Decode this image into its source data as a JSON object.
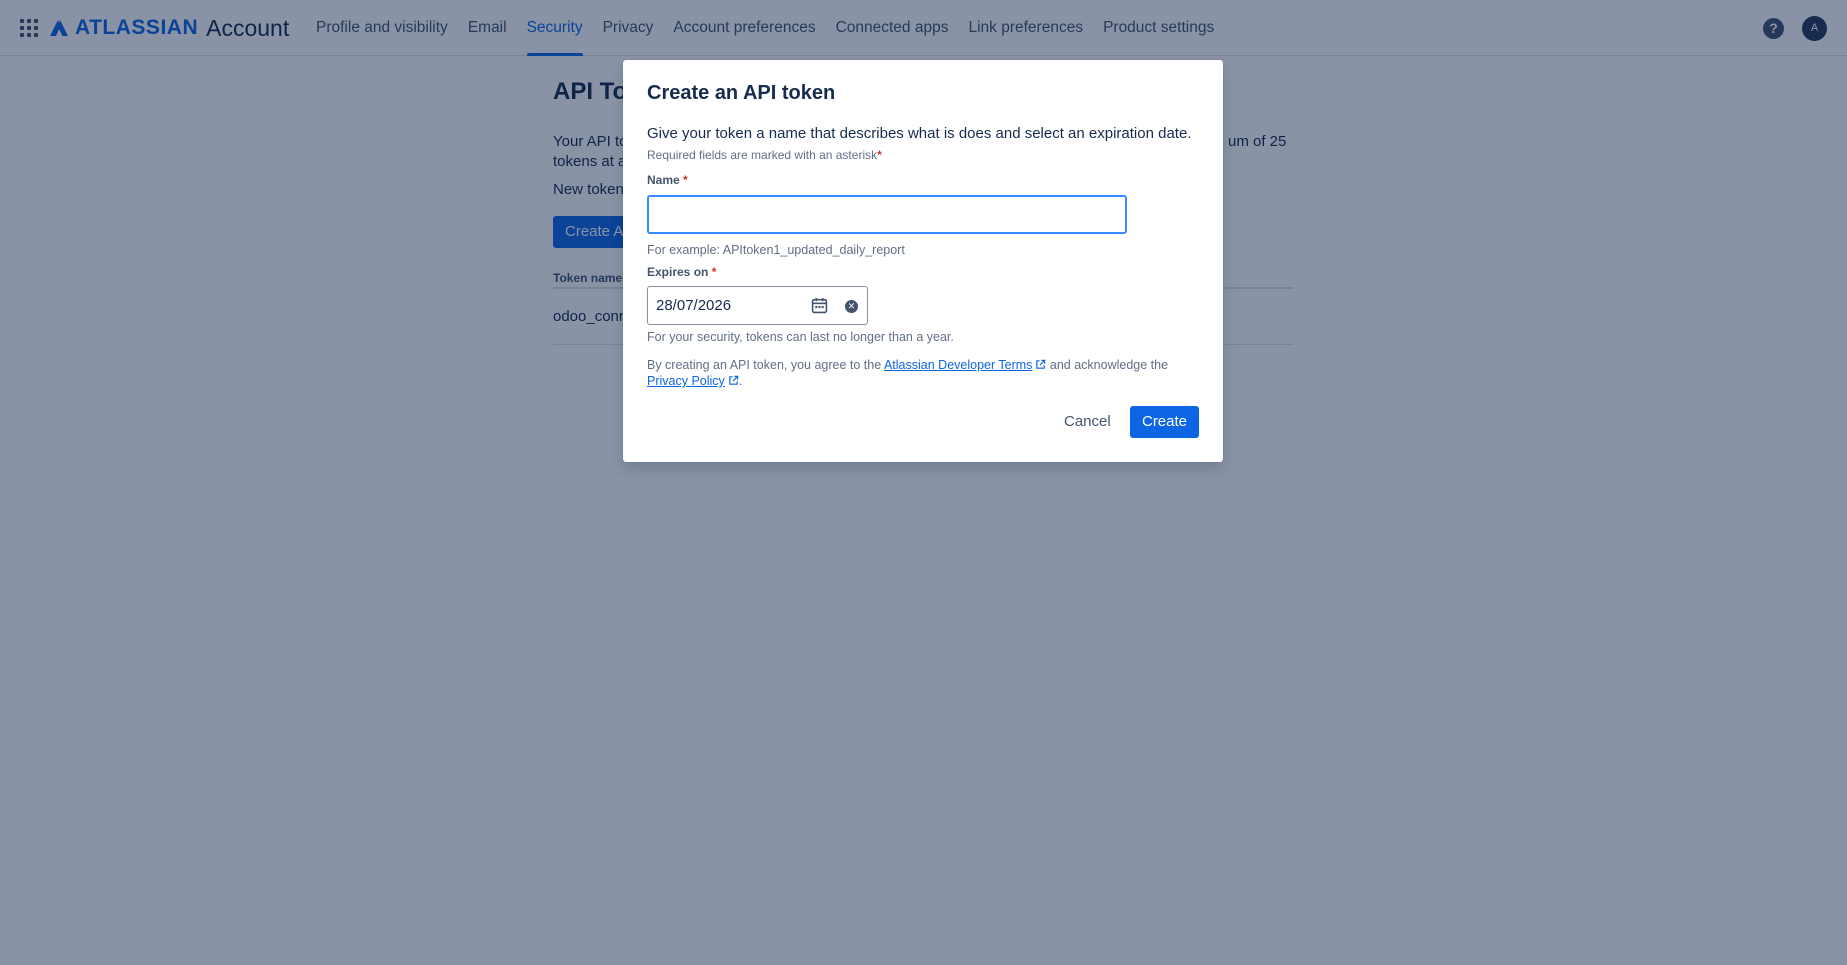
{
  "header": {
    "brand": "ATLASSIAN",
    "product": "Account",
    "nav": [
      {
        "label": "Profile and visibility"
      },
      {
        "label": "Email"
      },
      {
        "label": "Security"
      },
      {
        "label": "Privacy"
      },
      {
        "label": "Account preferences"
      },
      {
        "label": "Connected apps"
      },
      {
        "label": "Link preferences"
      },
      {
        "label": "Product settings"
      }
    ],
    "active_nav": "Security",
    "help_label": "?",
    "avatar_initial": "A"
  },
  "background_page": {
    "title": "API To",
    "description": "Your API to                                                                                                                                  um of 25 tokens at a",
    "description_left": "Your API to",
    "description_right": "um of 25",
    "description_line2": "tokens at a",
    "note": "New token",
    "create_button": "Create A",
    "table_header": "Token name",
    "row_token": "odoo_conr"
  },
  "modal": {
    "title": "Create an API token",
    "description": "Give your token a name that describes what is does and select an expiration date.",
    "required_note": "Required fields are marked with an asterisk",
    "required_mark": "*",
    "name_label": "Name",
    "name_value": "",
    "name_helper": "For example: APItoken1_updated_daily_report",
    "expires_label": "Expires on",
    "expires_value": "28/07/2026",
    "expires_helper": "For your security, tokens can last no longer than a year.",
    "terms_prefix": "By creating an API token, you agree to the ",
    "terms_link": "Atlassian Developer Terms",
    "terms_middle": " and acknowledge the",
    "privacy_link": "Privacy Policy",
    "terms_suffix": ".",
    "cancel_label": "Cancel",
    "create_label": "Create"
  },
  "colors": {
    "brand": "#0c66e4",
    "text": "#172b4d",
    "subtle": "#626f86",
    "focus": "#388bff",
    "required": "#c9372c"
  }
}
